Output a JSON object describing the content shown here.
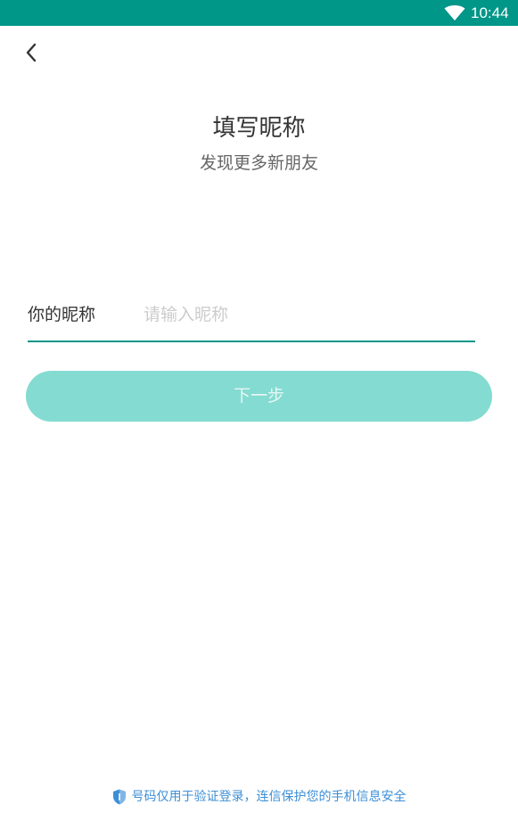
{
  "status_bar": {
    "time": "10:44",
    "wifi_icon": "wifi-icon",
    "background_color": "#009688"
  },
  "nav": {
    "back_icon": "chevron-left-icon"
  },
  "header": {
    "title": "填写昵称",
    "subtitle": "发现更多新朋友"
  },
  "form": {
    "nickname_label": "你的昵称",
    "nickname_placeholder": "请输入昵称",
    "nickname_value": "",
    "underline_color": "#009688"
  },
  "next_button": {
    "label": "下一步",
    "color": "#84dbd1"
  },
  "footer": {
    "icon": "shield-icon",
    "security_text": "号码仅用于验证登录，连信保护您的手机信息安全",
    "text_color": "#3c8fd6"
  }
}
